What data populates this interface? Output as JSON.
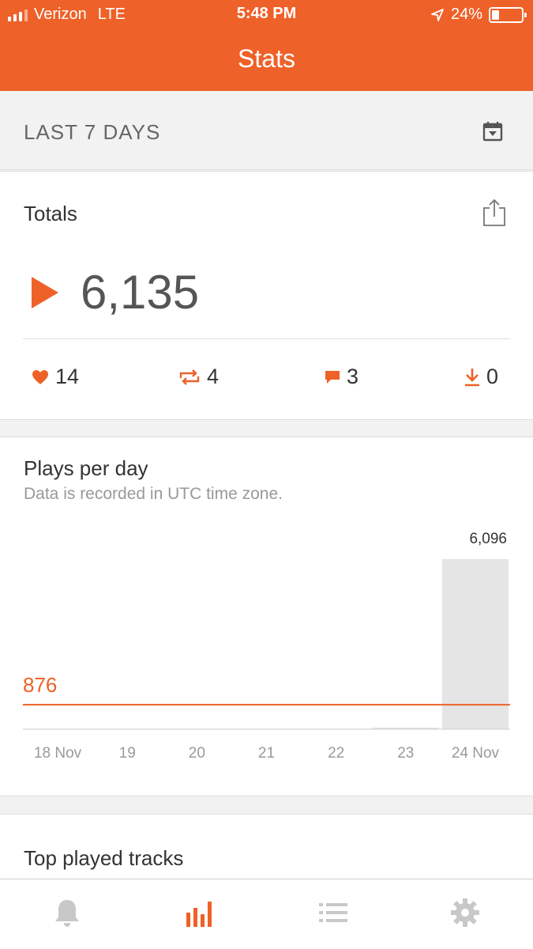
{
  "status_bar": {
    "carrier": "Verizon",
    "network": "LTE",
    "time": "5:48 PM",
    "battery": "24%",
    "battery_fraction": 0.24
  },
  "nav": {
    "title": "Stats"
  },
  "range": {
    "label": "LAST 7 DAYS",
    "icon": "calendar-icon"
  },
  "totals": {
    "title": "Totals",
    "plays": "6,135",
    "likes": "14",
    "reposts": "4",
    "comments": "3",
    "downloads": "0"
  },
  "chart": {
    "title": "Plays per day",
    "subtitle": "Data is recorded in UTC time zone."
  },
  "chart_data": {
    "type": "bar",
    "categories": [
      "18 Nov",
      "19",
      "20",
      "21",
      "22",
      "23",
      "24 Nov"
    ],
    "values": [
      0,
      0,
      0,
      0,
      0,
      39,
      6096
    ],
    "data_labels": {
      "24 Nov": "6,096"
    },
    "reference_line": {
      "value": 876,
      "label": "876"
    },
    "ylim": [
      0,
      6096
    ],
    "grid": false
  },
  "top_tracks": {
    "title": "Top played tracks"
  },
  "tabs": [
    {
      "name": "notifications",
      "icon": "bell-icon"
    },
    {
      "name": "stats",
      "icon": "bar-chart-icon",
      "active": true
    },
    {
      "name": "tracks",
      "icon": "list-icon"
    },
    {
      "name": "settings",
      "icon": "gear-icon"
    }
  ],
  "colors": {
    "accent": "#ee6128",
    "bar": "#e5e5e5",
    "muted": "#999999"
  }
}
